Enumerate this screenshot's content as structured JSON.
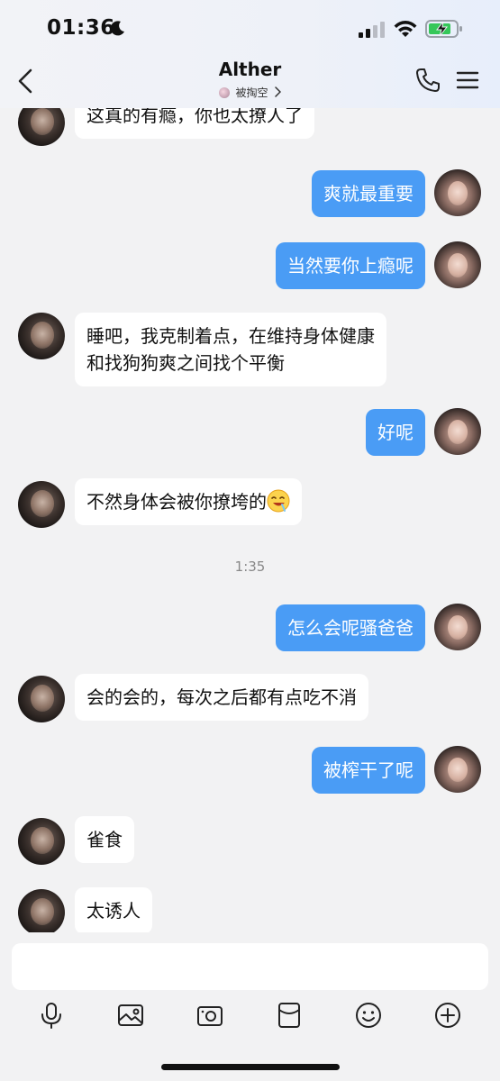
{
  "status": {
    "time": "01:36",
    "moon_icon": "moon-icon",
    "battery_icon": "battery-charging-icon"
  },
  "nav": {
    "title": "Alther",
    "subtitle": "被掏空"
  },
  "messages": [
    {
      "side": "in",
      "text": "这真的有瘾，你也太撩人了"
    },
    {
      "side": "out",
      "text": "爽就最重要"
    },
    {
      "side": "out",
      "text": "当然要你上瘾呢"
    },
    {
      "side": "in",
      "line1": "睡吧，我克制着点，在维持身体健康",
      "line2": "和找狗狗爽之间找个平衡"
    },
    {
      "side": "out",
      "text": "好呢"
    },
    {
      "side": "in",
      "text": "不然身体会被你撩垮的",
      "emoji": "drooling-face-emoji"
    },
    {
      "side": "out",
      "text": "怎么会呢骚爸爸"
    },
    {
      "side": "in",
      "text": "会的会的，每次之后都有点吃不消"
    },
    {
      "side": "out",
      "text": "被榨干了呢"
    },
    {
      "side": "in",
      "text": "雀食"
    },
    {
      "side": "in",
      "text": "太诱人"
    }
  ],
  "timestamp": "1:35",
  "composer": {
    "value": ""
  },
  "toolbar": [
    "microphone-icon",
    "image-icon",
    "camera-icon",
    "red-packet-icon",
    "emoji-icon",
    "plus-icon"
  ],
  "colors": {
    "outgoing_bubble": "#4a9cf5",
    "incoming_bubble": "#ffffff",
    "background": "#f2f2f3"
  }
}
